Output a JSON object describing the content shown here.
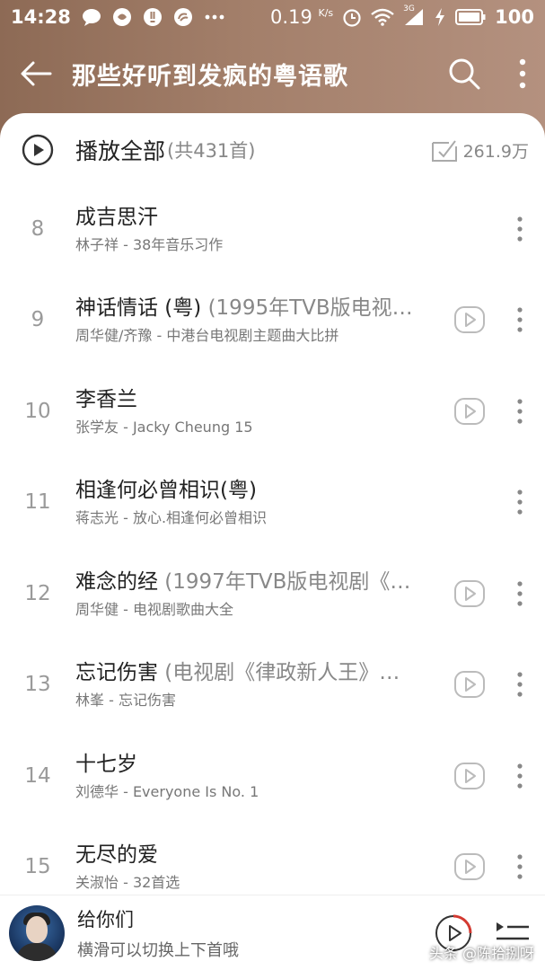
{
  "status_bar": {
    "time": "14:28",
    "net_speed": "0.19",
    "net_unit": "K/s",
    "battery": "100",
    "signal_label": "3G"
  },
  "header": {
    "title": "那些好听到发疯的粤语歌",
    "icons": [
      "back-arrow-icon",
      "search-icon",
      "more-vert-icon"
    ]
  },
  "play_all": {
    "label": "播放全部",
    "count": "(共431首)",
    "collect_count": "261.9万"
  },
  "songs": [
    {
      "index": "8",
      "title": "成吉思汗",
      "extra": "",
      "subtitle": "林子祥 - 38年音乐习作",
      "has_mv": false
    },
    {
      "index": "9",
      "title": "神话情话 (粤)",
      "extra": " (1995年TVB版电视…",
      "subtitle": "周华健/齐豫 - 中港台电视剧主题曲大比拼",
      "has_mv": true
    },
    {
      "index": "10",
      "title": "李香兰",
      "extra": "",
      "subtitle": "张学友 - Jacky Cheung 15",
      "has_mv": true
    },
    {
      "index": "11",
      "title": "相逢何必曾相识(粤)",
      "extra": "",
      "subtitle": "蒋志光 - 放心.相逢何必曾相识",
      "has_mv": false
    },
    {
      "index": "12",
      "title": "难念的经",
      "extra": " (1997年TVB版电视剧《…",
      "subtitle": "周华健 - 电视剧歌曲大全",
      "has_mv": true
    },
    {
      "index": "13",
      "title": "忘记伤害",
      "extra": " (电视剧《律政新人王》…",
      "subtitle": "林峯 - 忘记伤害",
      "has_mv": true
    },
    {
      "index": "14",
      "title": "十七岁",
      "extra": "",
      "subtitle": "刘德华 - Everyone Is No. 1",
      "has_mv": true
    },
    {
      "index": "15",
      "title": "无尽的爱",
      "extra": "",
      "subtitle": "关淑怡 - 32首选",
      "has_mv": true
    }
  ],
  "mini_player": {
    "title": "给你们",
    "hint": "横滑可以切换上下首哦"
  },
  "watermark": "头条 @陈拾捌呀",
  "colors": {
    "header_bg": "#a37f6a",
    "accent_red": "#d33a31",
    "icon_gray": "#bbbbbb"
  }
}
